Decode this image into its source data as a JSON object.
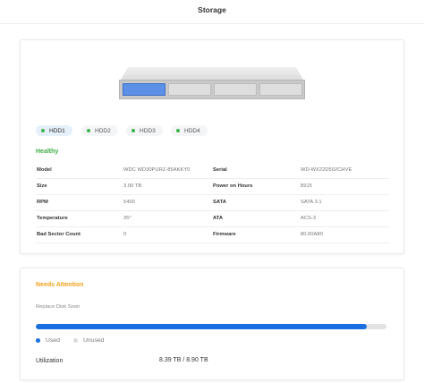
{
  "header": {
    "title": "Storage"
  },
  "disks": {
    "tabs": [
      {
        "label": "HDD1",
        "active": true
      },
      {
        "label": "HDD2",
        "active": false
      },
      {
        "label": "HDD3",
        "active": false
      },
      {
        "label": "HDD4",
        "active": false
      }
    ],
    "selected_bay": 1,
    "status": "Healthy",
    "status_color": "#3fae49"
  },
  "details": {
    "rows": [
      {
        "left_label": "Model",
        "left_value": "WDC WD30PURZ-85AKKY0",
        "right_label": "Serial",
        "right_value": "WD-WX22D502CHVE"
      },
      {
        "left_label": "Size",
        "left_value": "3.00 TB",
        "right_label": "Power on Hours",
        "right_value": "8915"
      },
      {
        "left_label": "RPM",
        "left_value": "5400",
        "right_label": "SATA",
        "right_value": "SATA 3.1"
      },
      {
        "left_label": "Temperature",
        "left_value": "35°",
        "right_label": "ATA",
        "right_value": "ACS-3"
      },
      {
        "left_label": "Bad Sector Count",
        "left_value": "0",
        "right_label": "Firmware",
        "right_value": "80.00A80"
      }
    ]
  },
  "storage": {
    "attention_title": "Needs Attention",
    "attention_color": "#f0a21d",
    "message": "Replace Disk Soon",
    "used_fraction": 0.943,
    "used_color": "#1a6fe0",
    "unused_color": "#dcdcdc",
    "legend_used": "Used",
    "legend_unused": "Unused",
    "utilization_label": "Utilization",
    "utilization_value": "8.39 TB / 8.90 TB"
  }
}
